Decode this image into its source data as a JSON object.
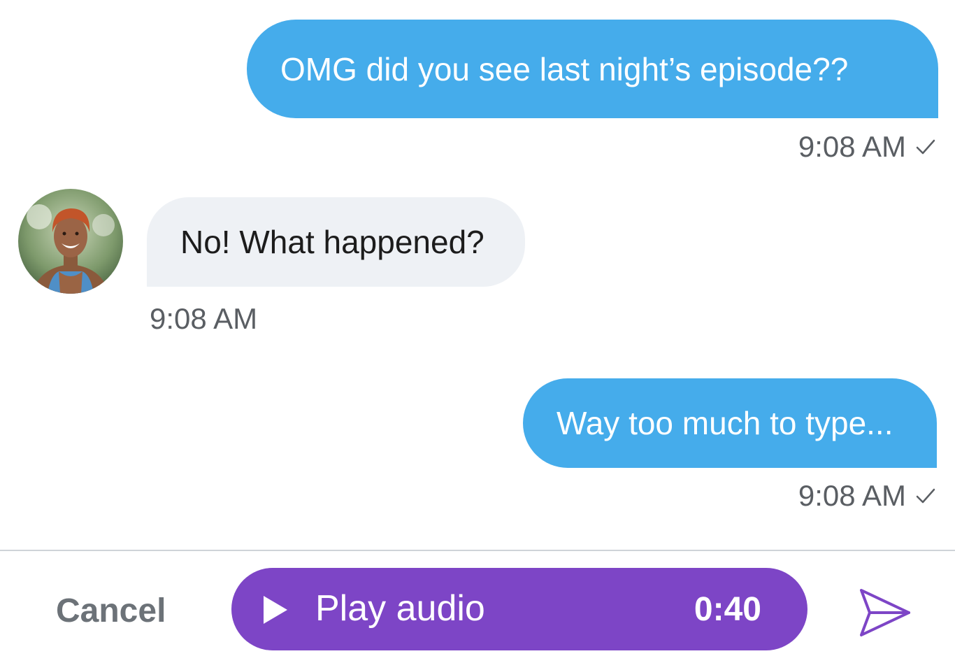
{
  "messages": [
    {
      "direction": "sent",
      "text": "OMG did you see last night’s episode??",
      "time": "9:08 AM",
      "status": "delivered-check"
    },
    {
      "direction": "received",
      "text": "No! What happened?",
      "time": "9:08 AM"
    },
    {
      "direction": "sent",
      "text": "Way too much to type...",
      "time": "9:08 AM",
      "status": "delivered-check"
    }
  ],
  "composer": {
    "cancel_label": "Cancel",
    "audio_label": "Play audio",
    "audio_duration": "0:40",
    "play_icon": "play-icon",
    "send_icon": "send-icon"
  },
  "colors": {
    "sent_bubble": "#45aceb",
    "received_bubble": "#eef1f5",
    "audio_pill": "#7d45c6",
    "send_icon": "#7d45c6"
  }
}
